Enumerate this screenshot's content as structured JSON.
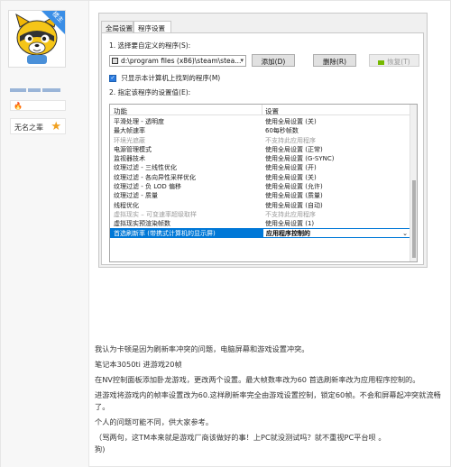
{
  "badge": {
    "corner_text": "楼主"
  },
  "user": {
    "title": "无名之辈"
  },
  "nvidia": {
    "tabs": [
      "全局设置",
      "程序设置"
    ],
    "section1_label": "1. 选择要自定义的程序(S):",
    "program_path": "d:\\program files (x86)\\steam\\steа...",
    "buttons": {
      "add": "添加(D)",
      "delete": "删除(R)",
      "restore": "恢复(T)"
    },
    "checkbox_label": "只显示本计算机上找到的程序(M)",
    "section2_label": "2. 指定该程序的设置值(E):",
    "columns": {
      "feature": "功能",
      "setting": "设置"
    },
    "rows": [
      {
        "feature": "平滑处理 - 透明度",
        "setting": "使用全局设置 (关)",
        "dim": false
      },
      {
        "feature": "最大帧速率",
        "setting": "60每秒帧数",
        "dim": false
      },
      {
        "feature": "环境光遮蔽",
        "setting": "不支持此应用程序",
        "dim": true
      },
      {
        "feature": "电源管理模式",
        "setting": "使用全局设置 (正常)",
        "dim": false
      },
      {
        "feature": "监视器技术",
        "setting": "使用全局设置 (G-SYNC)",
        "dim": false
      },
      {
        "feature": "纹理过滤 - 三线性优化",
        "setting": "使用全局设置 (开)",
        "dim": false
      },
      {
        "feature": "纹理过滤 - 各向异性采样优化",
        "setting": "使用全局设置 (关)",
        "dim": false
      },
      {
        "feature": "纹理过滤 - 负 LOD 偏移",
        "setting": "使用全局设置 (允许)",
        "dim": false
      },
      {
        "feature": "纹理过滤 - 质量",
        "setting": "使用全局设置 (质量)",
        "dim": false
      },
      {
        "feature": "线程优化",
        "setting": "使用全局设置 (自动)",
        "dim": false
      },
      {
        "feature": "虚拟现实 – 可变速率超级取样",
        "setting": "不支持此应用程序",
        "dim": true
      },
      {
        "feature": "虚拟现实预渲染帧数",
        "setting": "使用全局设置 (1)",
        "dim": false
      }
    ],
    "selected_row": {
      "feature": "首选刷新率 (带携式计算机的显示屏)",
      "setting": "应用程序控制的"
    }
  },
  "post": {
    "paragraphs": [
      "我认为卡顿是因为刷新率冲突的问题，电脑屏幕和游戏设置冲突。",
      "笔记本3050ti 进游戏20帧",
      "在NV控制面板添加卧龙游戏，更改两个设置。最大帧数率改为60 首选刷新率改为应用程序控制的。",
      "进游戏将游戏内的帧率设置改为60.这样刷新率完全由游戏设置控制，锁定60帧。不会和屏幕起冲突就流畅了。",
      "个人的问题可能不同，供大家参考。",
      "（骂两句，这TM本来就是游戏厂商该做好的事！上PC就没测试吗？就不重视PC平台呗 。",
      "狗)"
    ]
  }
}
